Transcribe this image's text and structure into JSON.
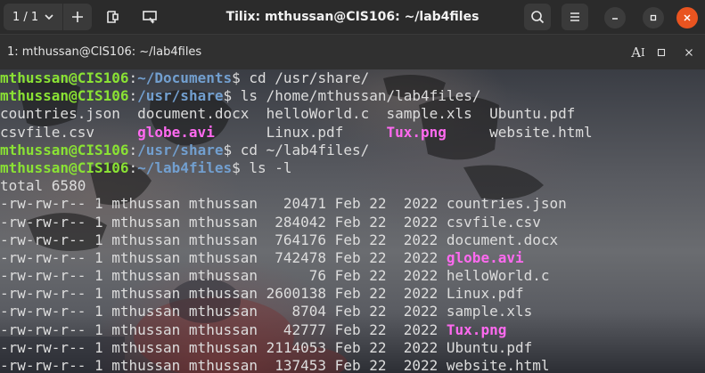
{
  "header": {
    "session_label": "1 / 1",
    "title": "Tilix: mthussan@CIS106: ~/lab4files"
  },
  "terminal_bar": {
    "title": "1: mthussan@CIS106: ~/lab4files",
    "font_icon_text": "A"
  },
  "prompt": {
    "user_host": "mthussan@CIS106",
    "separator": ":",
    "symbol": "$"
  },
  "commands": [
    {
      "path": "~/Documents",
      "cmd": " cd /usr/share/"
    },
    {
      "path": "/usr/share",
      "cmd": " ls /home/mthussan/lab4files/"
    },
    {
      "path": "/usr/share",
      "cmd": " cd ~/lab4files/"
    },
    {
      "path": "~/lab4files",
      "cmd": " ls -l"
    }
  ],
  "ls_output": {
    "row1": [
      "countries.json  ",
      "document.docx  ",
      "helloWorld.c  ",
      "sample.xls  ",
      "Ubuntu.pdf"
    ],
    "row2": [
      "csvfile.csv     ",
      "globe.avi",
      "      ",
      "Linux.pdf     ",
      "Tux.png",
      "     ",
      "website.html"
    ]
  },
  "total_line": "total 6580",
  "files": [
    {
      "perm": "-rw-rw-r--",
      "links": "1",
      "owner": "mthussan",
      "group": "mthussan",
      "size": "20471",
      "date": "Feb 22  2022",
      "name": "countries.json",
      "media": false
    },
    {
      "perm": "-rw-rw-r--",
      "links": "1",
      "owner": "mthussan",
      "group": "mthussan",
      "size": "284042",
      "date": "Feb 22  2022",
      "name": "csvfile.csv",
      "media": false
    },
    {
      "perm": "-rw-rw-r--",
      "links": "1",
      "owner": "mthussan",
      "group": "mthussan",
      "size": "764176",
      "date": "Feb 22  2022",
      "name": "document.docx",
      "media": false
    },
    {
      "perm": "-rw-rw-r--",
      "links": "1",
      "owner": "mthussan",
      "group": "mthussan",
      "size": "742478",
      "date": "Feb 22  2022",
      "name": "globe.avi",
      "media": true
    },
    {
      "perm": "-rw-rw-r--",
      "links": "1",
      "owner": "mthussan",
      "group": "mthussan",
      "size": "76",
      "date": "Feb 22  2022",
      "name": "helloWorld.c",
      "media": false
    },
    {
      "perm": "-rw-rw-r--",
      "links": "1",
      "owner": "mthussan",
      "group": "mthussan",
      "size": "2600138",
      "date": "Feb 22  2022",
      "name": "Linux.pdf",
      "media": false
    },
    {
      "perm": "-rw-rw-r--",
      "links": "1",
      "owner": "mthussan",
      "group": "mthussan",
      "size": "8704",
      "date": "Feb 22  2022",
      "name": "sample.xls",
      "media": false
    },
    {
      "perm": "-rw-rw-r--",
      "links": "1",
      "owner": "mthussan",
      "group": "mthussan",
      "size": "42777",
      "date": "Feb 22  2022",
      "name": "Tux.png",
      "media": true
    },
    {
      "perm": "-rw-rw-r--",
      "links": "1",
      "owner": "mthussan",
      "group": "mthussan",
      "size": "2114053",
      "date": "Feb 22  2022",
      "name": "Ubuntu.pdf",
      "media": false
    },
    {
      "perm": "-rw-rw-r--",
      "links": "1",
      "owner": "mthussan",
      "group": "mthussan",
      "size": "137453",
      "date": "Feb 22  2022",
      "name": "website.html",
      "media": false
    }
  ],
  "colors": {
    "prompt_user": "#8ae234",
    "prompt_path": "#729fcf",
    "media_file": "#ff6af0",
    "close_button": "#e95420"
  },
  "icons": [
    "chevron-down-icon",
    "plus-icon",
    "split-terminal-icon",
    "save-output-icon",
    "search-icon",
    "hamburger-menu-icon",
    "minimize-icon",
    "maximize-icon",
    "close-icon",
    "font-icon",
    "pane-maximize-icon",
    "pane-close-icon"
  ]
}
